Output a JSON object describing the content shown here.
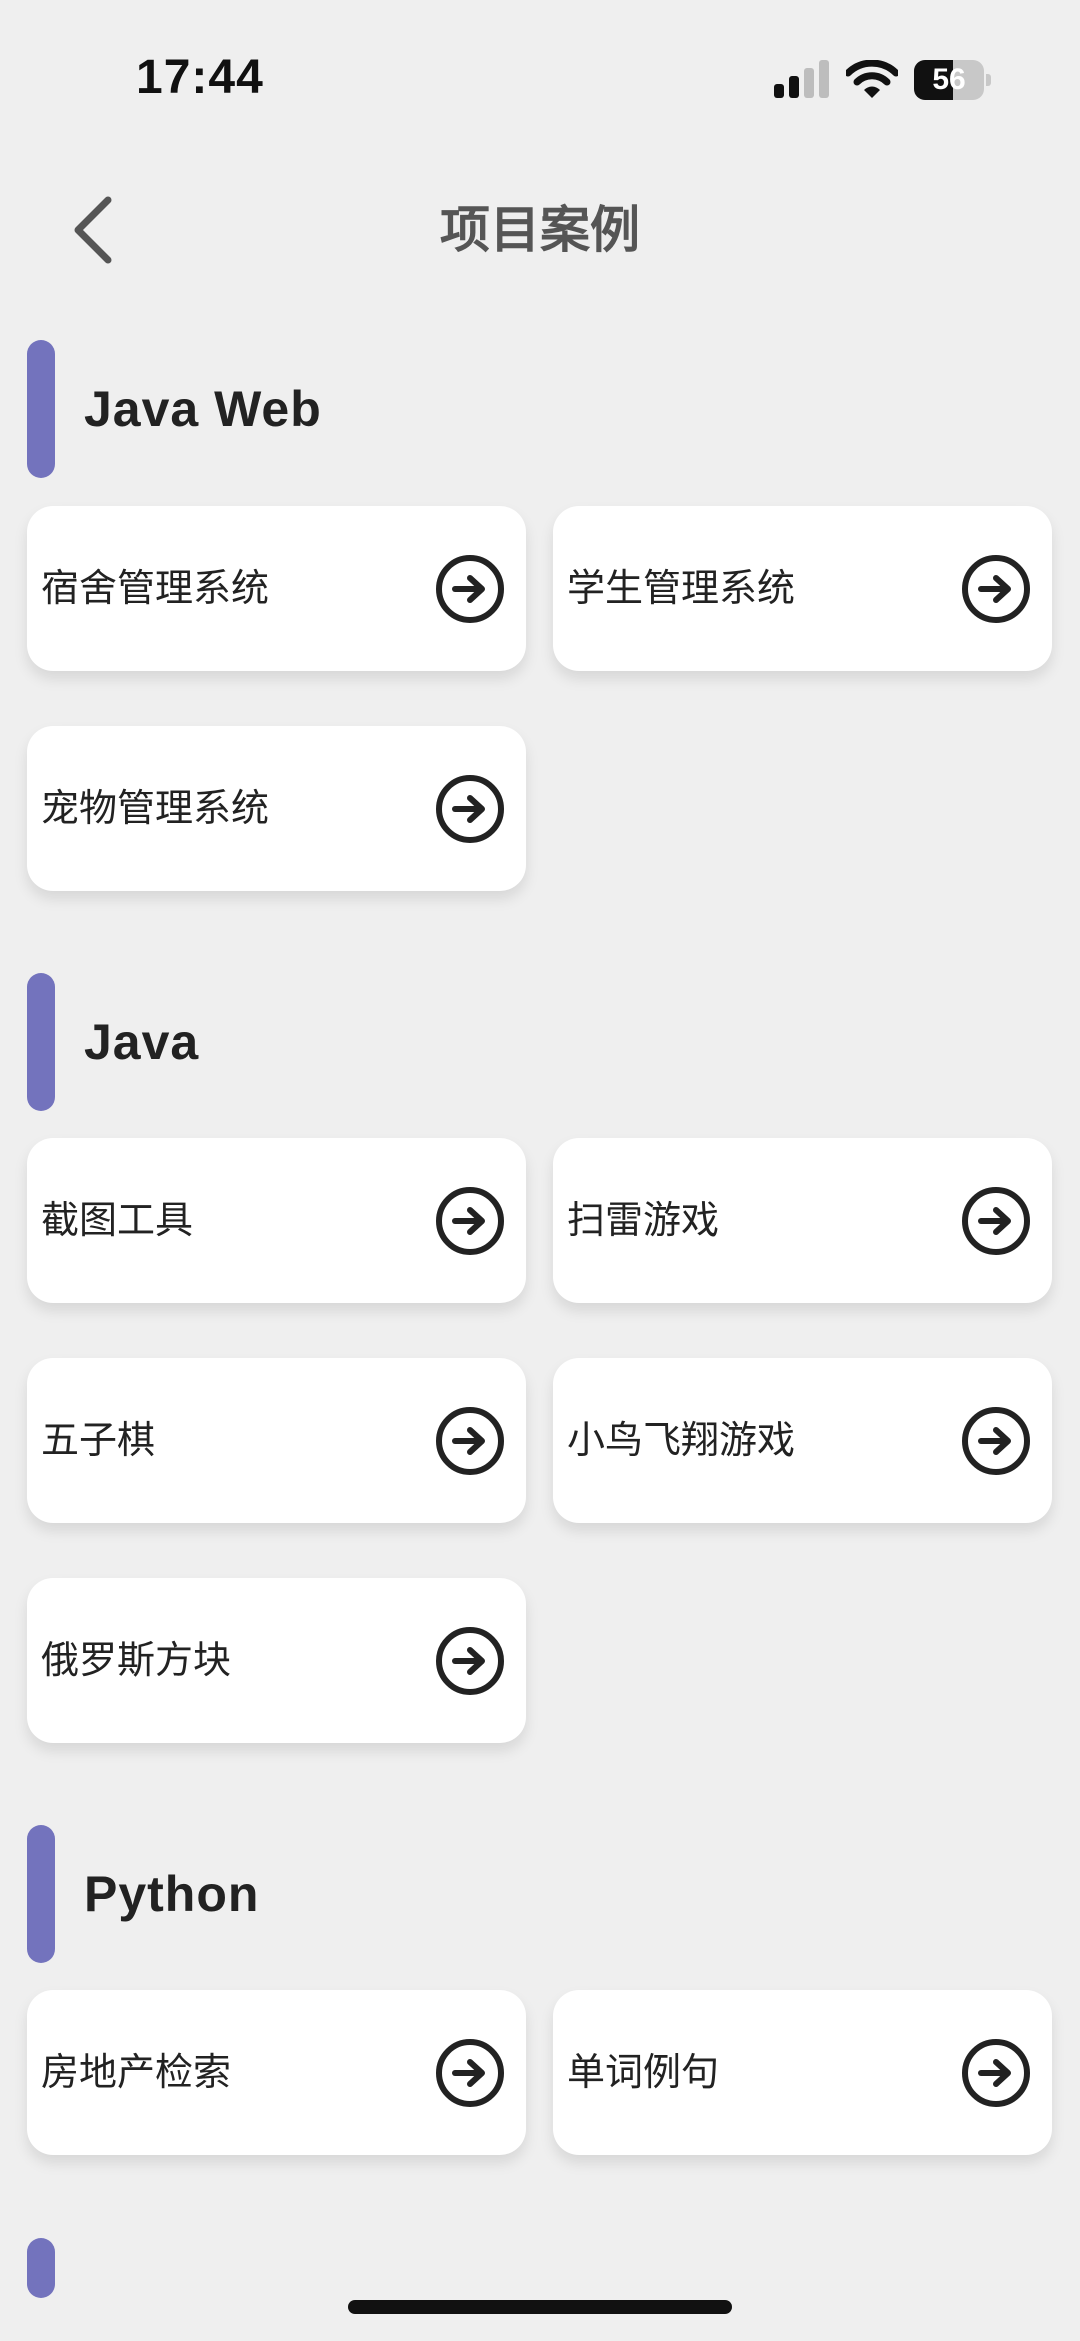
{
  "status_bar": {
    "time": "17:44",
    "battery_text": "56",
    "battery_level_percent": 56,
    "icons": [
      "signal-icon",
      "wifi-icon",
      "battery-icon"
    ]
  },
  "nav": {
    "title": "项目案例",
    "back_icon": "chevron-left-icon"
  },
  "sections": [
    {
      "title": "Java Web",
      "items": [
        "宿舍管理系统",
        "学生管理系统",
        "宠物管理系统"
      ]
    },
    {
      "title": "Java",
      "items": [
        "截图工具",
        "扫雷游戏",
        "五子棋",
        "小鸟飞翔游戏",
        "俄罗斯方块"
      ]
    },
    {
      "title": "Python",
      "items": [
        "房地产检索",
        "单词例句"
      ]
    }
  ],
  "card_icon": "arrow-right-circle-icon",
  "colors": {
    "background": "#efefef",
    "card": "#ffffff",
    "accent_bar": "#7373bd",
    "title_gray": "#555555",
    "text_dark": "#222222"
  }
}
